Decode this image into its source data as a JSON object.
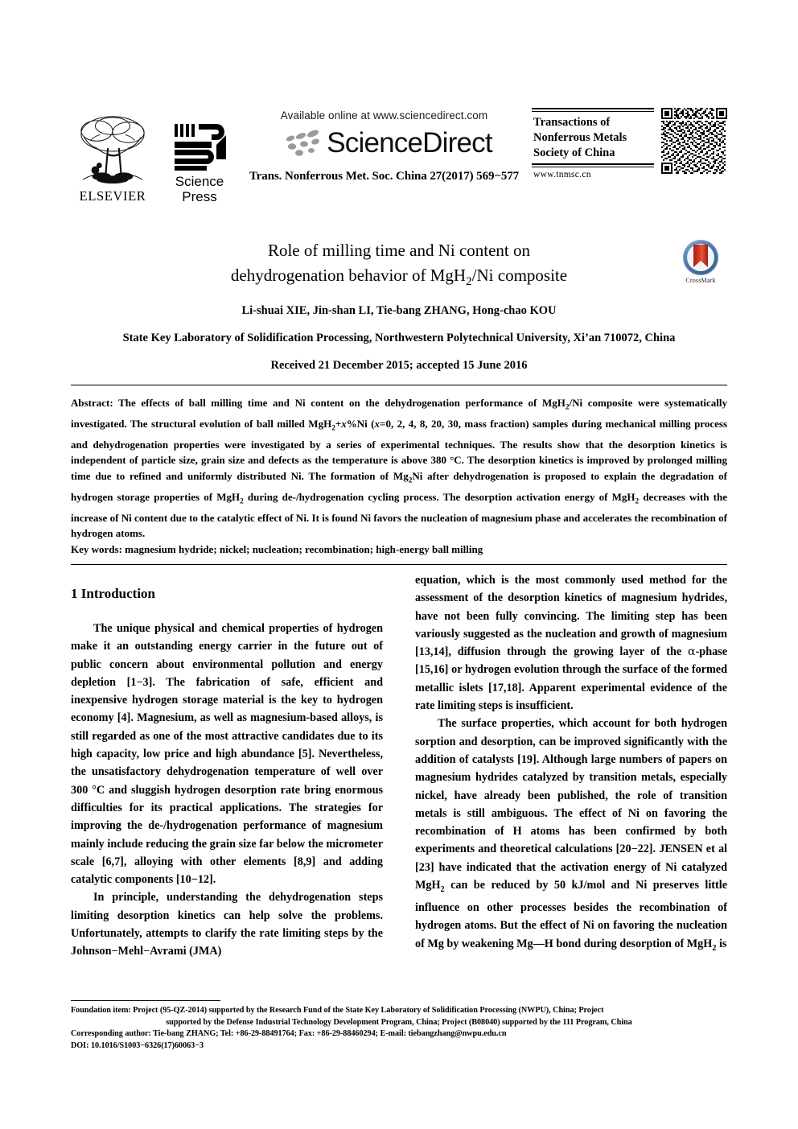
{
  "header": {
    "available_online": "Available online at www.sciencedirect.com",
    "sciencedirect_wordmark": "ScienceDirect",
    "journal_reference": "Trans. Nonferrous Met. Soc. China 27(2017) 569−577",
    "elsevier_label": "ELSEVIER",
    "science_press_line1": "Science",
    "science_press_line2": "Press",
    "society_title": "Transactions of Nonferrous Metals Society of China",
    "society_url": "www.tnmsc.cn",
    "qr_code_alt": "qr-code"
  },
  "title": {
    "line1": "Role of milling time and Ni content on",
    "line2_pre": "dehydrogenation behavior of MgH",
    "line2_sub": "2",
    "line2_post": "/Ni composite",
    "crossmark_label": "CrossMark"
  },
  "authors": {
    "list": "Li-shuai XIE, Jin-shan LI, Tie-bang ZHANG, Hong-chao KOU",
    "affiliation": "State Key Laboratory of Solidification Processing, Northwestern Polytechnical University, Xi’an 710072, China",
    "received": "Received 21 December 2015; accepted 15 June 2016"
  },
  "abstract": {
    "label": "Abstract:",
    "p1": " The effects of ball milling time and Ni content on the dehydrogenation performance of MgH",
    "p1_sub": "2",
    "p2": "/Ni composite were systematically investigated. The structural evolution of ball milled MgH",
    "p2_sub": "2",
    "p3": "+",
    "p3_ital": "x",
    "p4": "%Ni (",
    "p4_ital": "x",
    "p5": "=0, 2, 4, 8, 20, 30, mass fraction) samples during mechanical milling process and dehydrogenation properties were investigated by a series of experimental techniques. The results show that the desorption kinetics is independent of particle size, grain size and defects as the temperature is above 380 °C. The desorption kinetics is improved by prolonged milling time due to refined and uniformly distributed Ni. The formation of Mg",
    "p5_sub": "2",
    "p6": "Ni after dehydrogenation is proposed to explain the degradation of hydrogen storage properties of MgH",
    "p6_sub": "2",
    "p7": " during de-/hydrogenation cycling process. The desorption activation energy of MgH",
    "p7_sub": "2",
    "p8": " decreases with the increase of Ni content due to the catalytic effect of Ni. It is found Ni favors the nucleation of magnesium phase and accelerates the recombination of hydrogen atoms.",
    "keywords_label": "Key words:",
    "keywords_value": " magnesium hydride; nickel; nucleation; recombination; high-energy ball milling"
  },
  "body": {
    "section1_heading": "1 Introduction",
    "left_p1_a": "The unique physical and chemical properties of hydrogen make it an outstanding energy carrier in the future out of public concern about environmental pollution and energy depletion [1−3]. The fabrication of safe, efficient and inexpensive hydrogen storage material is the key to hydrogen economy [4]. Magnesium, as well as magnesium-based alloys, is still regarded as one of the most attractive candidates due to its high capacity, low price and high abundance [5]. Nevertheless, the unsatisfactory dehydrogenation temperature of well over 300 °C and sluggish hydrogen desorption rate bring enormous difficulties for its practical applications. The strategies for improving the de-/hydrogenation performance of magnesium mainly include reducing the grain size far below the micrometer scale [6,7], alloying with other elements [8,9] and adding catalytic components [10−12].",
    "left_p2": "In principle, understanding the dehydrogenation steps limiting desorption kinetics can help solve the problems. Unfortunately, attempts to clarify the rate limiting steps by the Johnson−Mehl−Avrami (JMA)",
    "right_p1_a": "equation, which is the most commonly used method for the assessment of the desorption kinetics of magnesium hydrides, have not been fully convincing. The limiting step has been variously suggested as the nucleation and growth of magnesium [13,14], diffusion through the growing layer of the ",
    "right_p1_greek": "α",
    "right_p1_b": "-phase [15,16] or hydrogen evolution through the surface of the formed metallic islets [17,18]. Apparent experimental evidence of the rate limiting steps is insufficient.",
    "right_p2_a": "The surface properties, which account for both hydrogen sorption and desorption, can be improved significantly with the addition of catalysts [19]. Although large numbers of papers on magnesium hydrides catalyzed by transition metals, especially nickel, have already been published, the role of transition metals is still ambiguous. The effect of Ni on favoring the recombination of H atoms has been confirmed by both experiments and theoretical calculations [20−22]. JENSEN et al [23] have indicated that the activation energy of Ni catalyzed MgH",
    "right_p2_sub": "2",
    "right_p2_b": " can be reduced by 50 kJ/mol and Ni preserves little influence on other processes besides the recombination of hydrogen atoms. But the effect of Ni on favoring the nucleation of Mg by weakening Mg",
    "right_p2_dash": "—",
    "right_p2_c": "H bond during desorption of MgH",
    "right_p2_sub2": "2",
    "right_p2_d": " is"
  },
  "footnote": {
    "foundation_label": "Foundation item:",
    "foundation_line1": " Project (95-QZ-2014) supported by the Research Fund of the State Key Laboratory of Solidification Processing (NWPU), China; Project",
    "foundation_line2": "supported by the Defense Industrial Technology Development Program, China; Project (B08040) supported by the 111 Program, China",
    "corresponding_label": "Corresponding author:",
    "corresponding_value": " Tie-bang ZHANG; Tel: +86-29-88491764; Fax: +86-29-88460294; E-mail: tiebangzhang@nwpu.edu.cn",
    "doi_label": "DOI:",
    "doi_value": " 10.1016/S1003−6326(17)60063−3"
  },
  "colors": {
    "text": "#000000",
    "crossmark_blue": "#3f6fa5",
    "crossmark_red": "#d4361f"
  }
}
